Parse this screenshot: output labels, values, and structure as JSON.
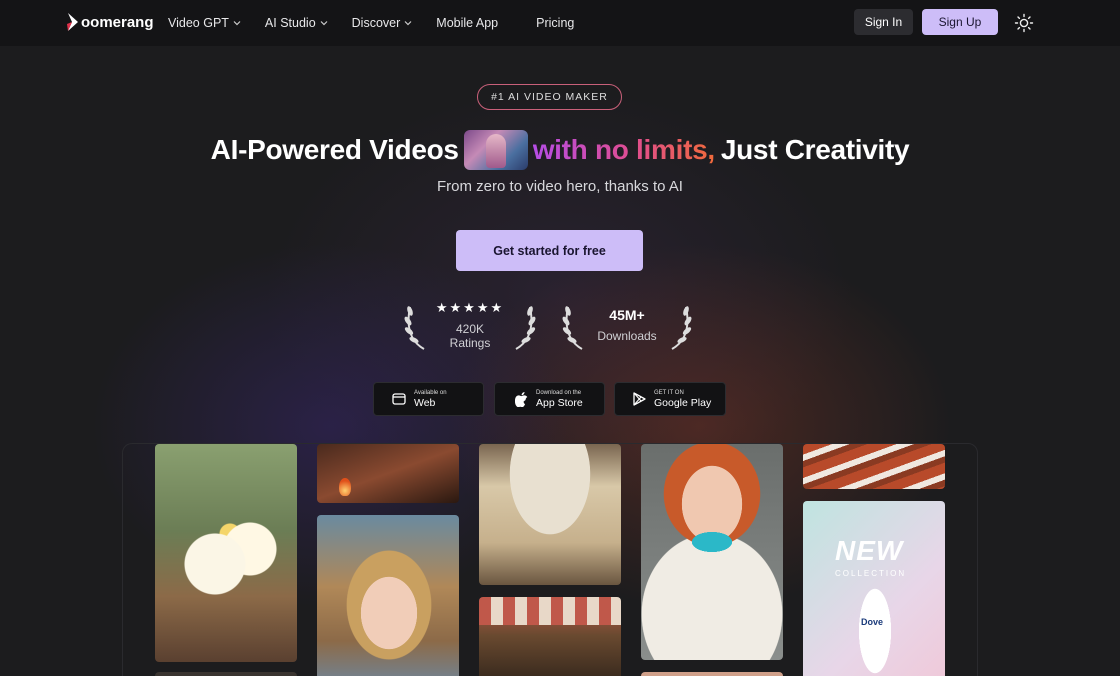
{
  "nav": {
    "logo_text": "oomerang",
    "links": [
      {
        "label": "Video GPT",
        "has_dropdown": true
      },
      {
        "label": "AI Studio",
        "has_dropdown": true
      },
      {
        "label": "Discover",
        "has_dropdown": true
      },
      {
        "label": "Mobile App",
        "has_dropdown": false
      },
      {
        "label": "Pricing",
        "has_dropdown": false
      }
    ],
    "sign_in": "Sign In",
    "sign_up": "Sign Up",
    "theme_icon": "sun-icon"
  },
  "hero": {
    "badge": "#1 AI VIDEO MAKER",
    "headline_part1": "AI-Powered Videos",
    "headline_gradient": "with no limits,",
    "headline_part2": "Just Creativity",
    "subline": "From zero to video hero, thanks to AI",
    "cta": "Get started for free"
  },
  "awards": [
    {
      "top": "★★★★★",
      "bottom": "420K Ratings"
    },
    {
      "top": "45M+",
      "bottom": "Downloads"
    }
  ],
  "stores": [
    {
      "small": "Available on",
      "label": "Web",
      "icon": "browser-icon"
    },
    {
      "small": "Download on the",
      "label": "App Store",
      "icon": "apple-icon"
    },
    {
      "small": "GET IT ON",
      "label": "Google Play",
      "icon": "google-play-icon"
    }
  ],
  "gallery": {
    "tile_text": {
      "new": "NEW",
      "collection": "COLLECTION",
      "brand": "Dove"
    }
  },
  "colors": {
    "accent": "#cdbdf8",
    "background": "#1c1c1e",
    "nav_bg": "#141416"
  }
}
